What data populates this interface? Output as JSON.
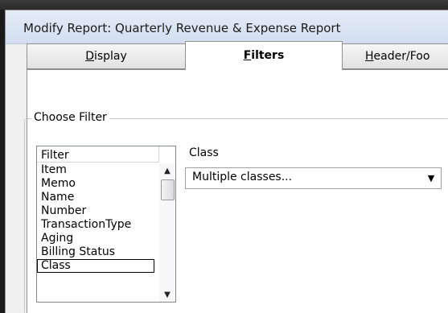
{
  "window": {
    "title": "Modify Report: Quarterly Revenue & Expense Report"
  },
  "tabs": [
    {
      "label": "Display",
      "mnemonic": "D",
      "rest": "isplay",
      "active": false
    },
    {
      "label": "Filters",
      "mnemonic": "F",
      "rest": "ilters",
      "active": true
    },
    {
      "label": "Header/Foo",
      "mnemonic": "H",
      "rest": "eader/Foo",
      "active": false
    }
  ],
  "filters": {
    "group_title": "Choose Filter",
    "list_header": "Filter",
    "items": [
      "Item",
      "Memo",
      "Name",
      "Number",
      "TransactionType",
      "Aging",
      "Billing Status",
      "Class"
    ],
    "selected_item": "Class",
    "field_label": "Class",
    "field_value": "Multiple classes..."
  },
  "icons": {
    "scroll_up": "scroll-up-arrow-icon",
    "scroll_down": "scroll-down-arrow-icon",
    "dropdown": "dropdown-arrow-icon"
  }
}
